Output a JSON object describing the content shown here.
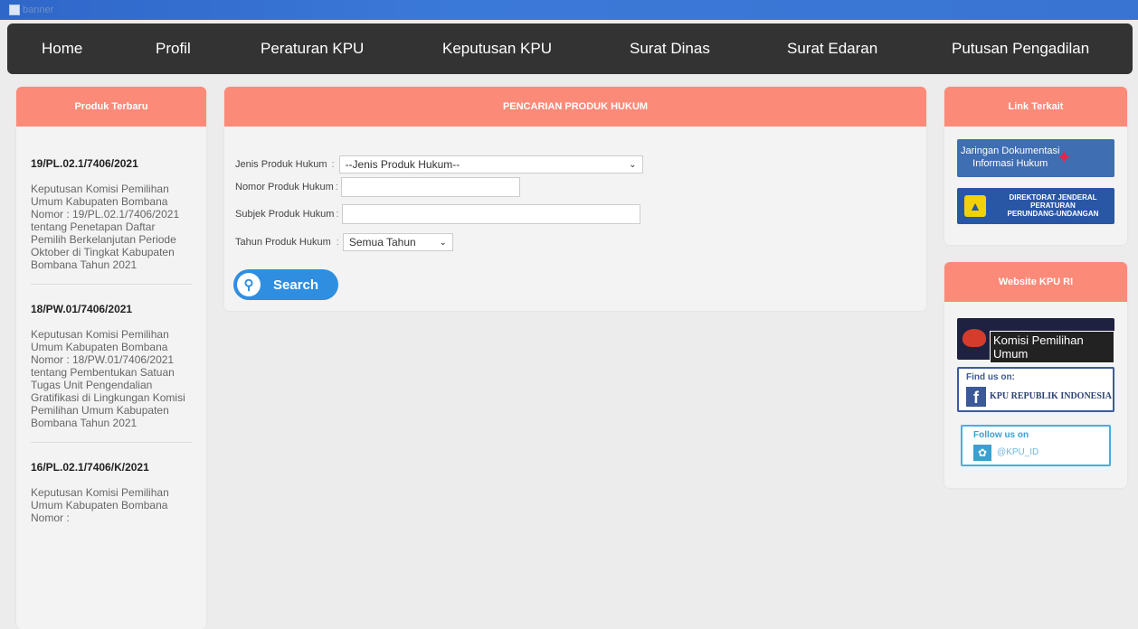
{
  "banner": {
    "alt": "banner"
  },
  "nav": {
    "items": [
      {
        "label": "Home"
      },
      {
        "label": "Profil"
      },
      {
        "label": "Peraturan KPU"
      },
      {
        "label": "Keputusan KPU"
      },
      {
        "label": "Surat Dinas"
      },
      {
        "label": "Surat Edaran"
      },
      {
        "label": "Putusan Pengadilan"
      }
    ]
  },
  "left": {
    "title": "Produk Terbaru",
    "posts": [
      {
        "code": "19/PL.02.1/7406/2021",
        "desc": "Keputusan Komisi Pemilihan Umum Kabupaten Bombana Nomor : 19/PL.02.1/7406/2021 tentang Penetapan Daftar Pemilih Berkelanjutan Periode Oktober di Tingkat Kabupaten Bombana Tahun 2021"
      },
      {
        "code": "18/PW.01/7406/2021",
        "desc": "Keputusan Komisi Pemilihan Umum Kabupaten Bombana Nomor : 18/PW.01/7406/2021 tentang Pembentukan Satuan Tugas Unit Pengendalian Gratifikasi di Lingkungan Komisi Pemilihan Umum Kabupaten Bombana Tahun 2021"
      },
      {
        "code": "16/PL.02.1/7406/K/2021",
        "desc": "Keputusan Komisi Pemilihan Umum Kabupaten Bombana Nomor :"
      }
    ]
  },
  "center": {
    "title": "PENCARIAN PRODUK HUKUM",
    "form": {
      "jenis_label": "Jenis Produk Hukum",
      "jenis_value": "--Jenis Produk Hukum--",
      "nomor_label": "Nomor Produk Hukum",
      "subjek_label": "Subjek Produk Hukum",
      "tahun_label": "Tahun Produk Hukum",
      "tahun_value": "Semua Tahun",
      "colon": ":"
    },
    "search_label": "Search"
  },
  "right": {
    "link_title": "Link Terkait",
    "jdih_text_1": "Jaringan Dokumentasi",
    "jdih_text_2": "Informasi Hukum",
    "ditjen_text_1": "DIREKTORAT JENDERAL",
    "ditjen_text_2": "PERATURAN",
    "ditjen_text_3": "PERUNDANG-UNDANGAN",
    "website_title": "Website KPU RI",
    "kpu_text": "Komisi Pemilihan Umum",
    "fb_find": "Find us on:",
    "fb_name": "KPU REPUBLIK INDONESIA",
    "tw_follow": "Follow us on",
    "tw_handle": "@KPU_ID"
  },
  "colors": {
    "nav_bg": "#333333",
    "panel_head": "#fc8a79",
    "search_btn": "#2f8ee0"
  }
}
